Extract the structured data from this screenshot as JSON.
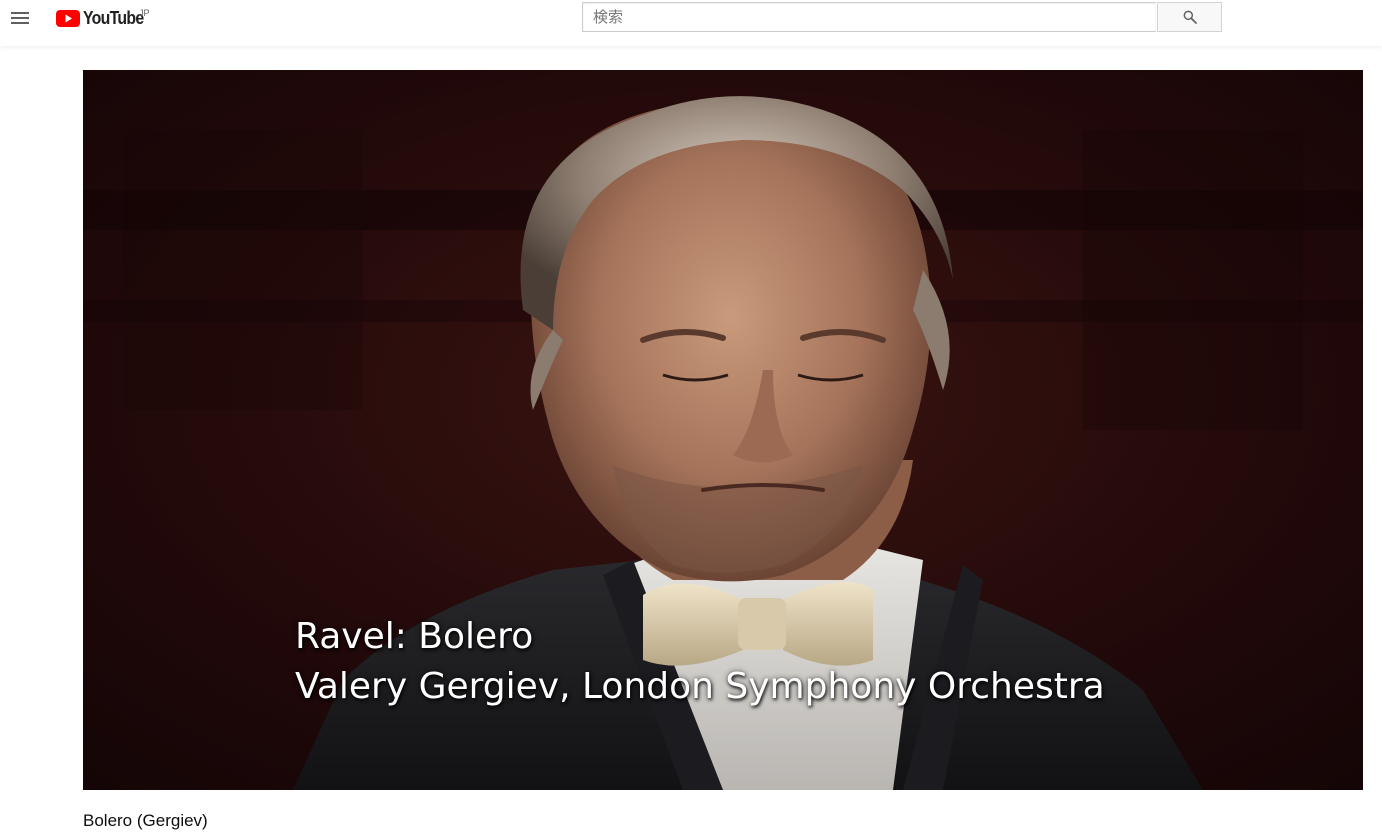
{
  "header": {
    "logo_text": "YouTube",
    "region_label": "JP",
    "menu_icon": "hamburger-menu-icon",
    "search": {
      "placeholder": "検索",
      "value": "",
      "button_icon": "search-icon"
    }
  },
  "player": {
    "caption_line1": "Ravel: Bolero",
    "caption_line2": "Valery Gergiev, London Symphony Orchestra"
  },
  "video": {
    "title": "Bolero (Gergiev)"
  },
  "colors": {
    "brand_red": "#ff0000",
    "masthead_bg": "#ffffff",
    "video_bg": "#1a0807",
    "icon_gray": "#606060"
  }
}
